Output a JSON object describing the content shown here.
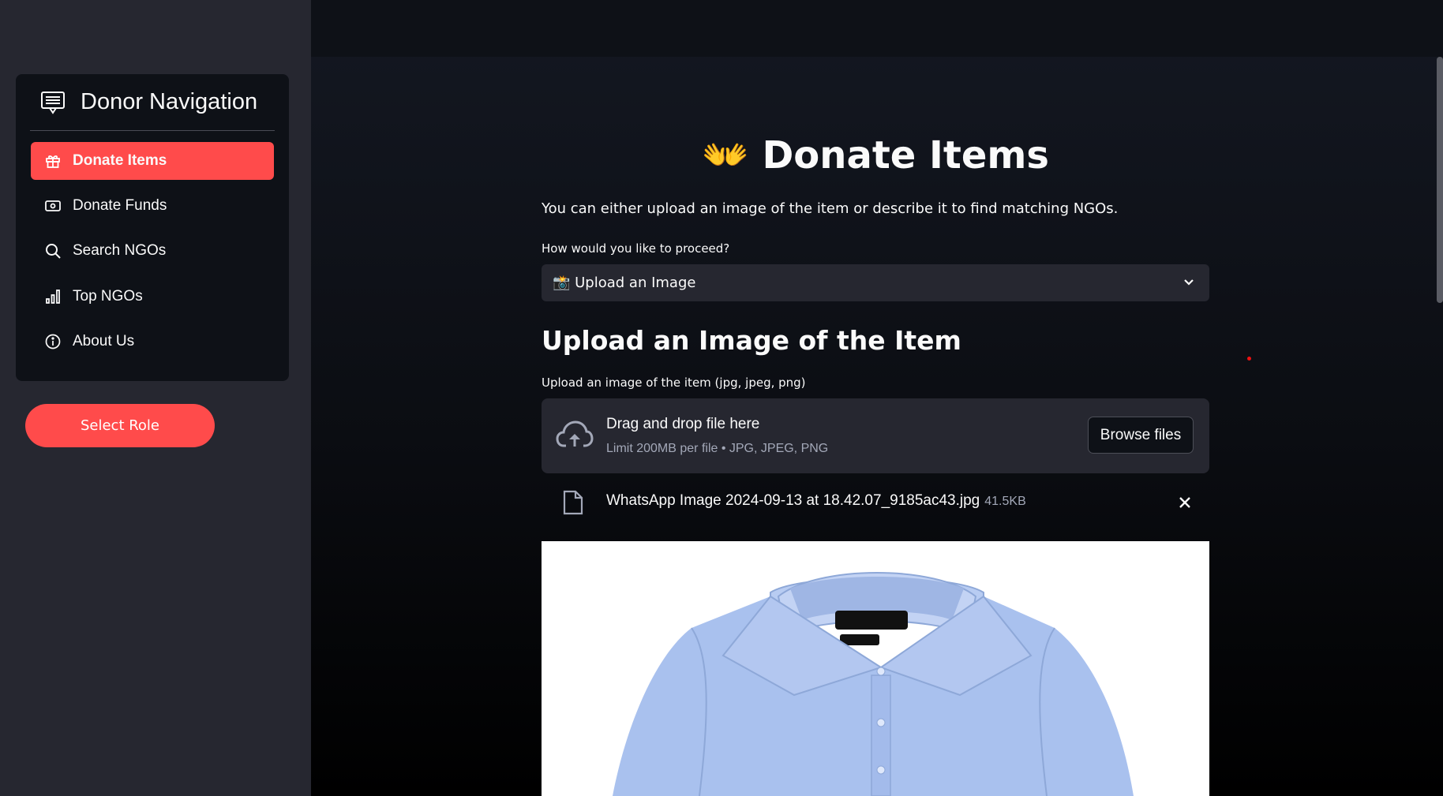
{
  "sidebar": {
    "title": "Donor Navigation",
    "title_icon": "list-alt-icon",
    "items": [
      {
        "label": "Donate Items",
        "icon": "gift-icon",
        "active": true
      },
      {
        "label": "Donate Funds",
        "icon": "cash-icon",
        "active": false
      },
      {
        "label": "Search NGOs",
        "icon": "search-icon",
        "active": false
      },
      {
        "label": "Top NGOs",
        "icon": "bar-chart-icon",
        "active": false
      },
      {
        "label": "About Us",
        "icon": "info-circle-icon",
        "active": false
      }
    ],
    "role_button": "Select Role"
  },
  "main": {
    "title": "👐 Donate Items",
    "subtitle": "You can either upload an image of the item or describe it to find matching NGOs.",
    "proceed_label": "How would you like to proceed?",
    "proceed_value": "📸 Upload an Image",
    "section_title": "Upload an Image of the Item",
    "upload_label": "Upload an image of the item (jpg, jpeg, png)",
    "dropzone": {
      "main_text": "Drag and drop file here",
      "sub_text": "Limit 200MB per file • JPG, JPEG, PNG",
      "browse_label": "Browse files"
    },
    "file": {
      "name": "WhatsApp Image 2024-09-13 at 18.42.07_9185ac43.jpg",
      "size": "41.5KB"
    }
  },
  "colors": {
    "accent": "#ff4b4b",
    "sidebar_bg": "#262730",
    "main_bg": "#0e1117",
    "shirt": "#a9c1ee"
  }
}
